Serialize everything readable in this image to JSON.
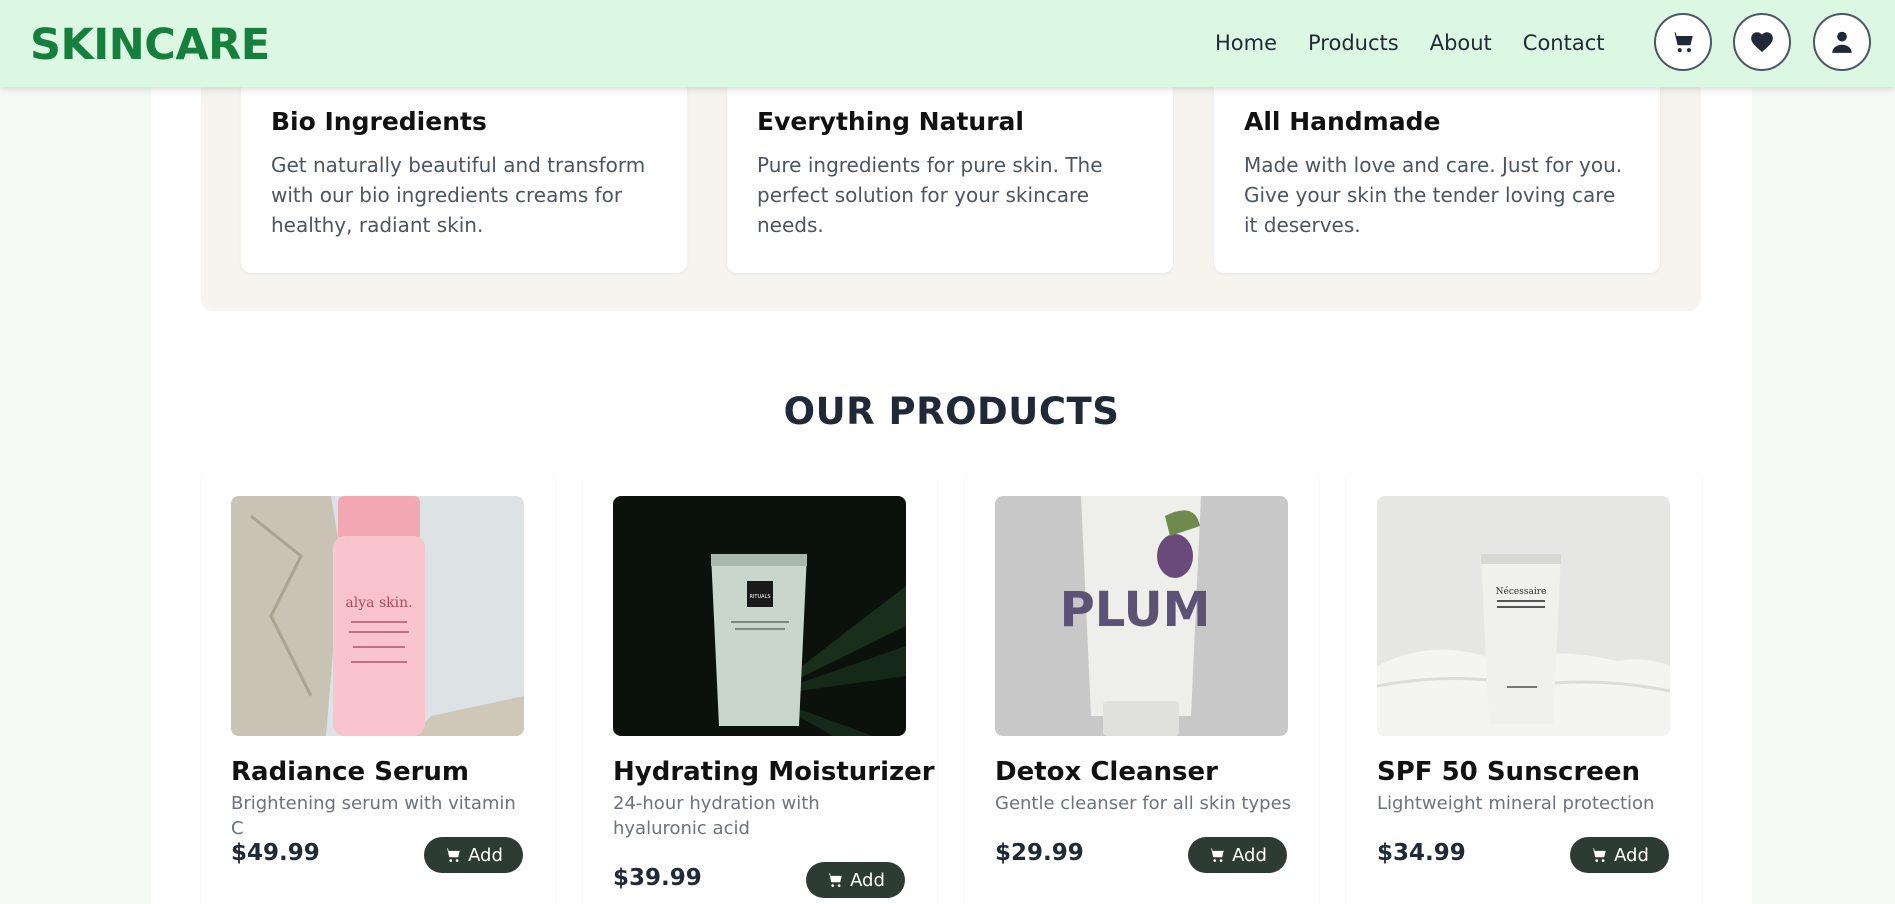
{
  "brand": {
    "logo": "SKINCARE"
  },
  "nav": {
    "items": [
      "Home",
      "Products",
      "About",
      "Contact"
    ]
  },
  "header_icons": [
    "cart-icon",
    "heart-icon",
    "user-icon"
  ],
  "features": [
    {
      "title": "Bio Ingredients",
      "text": "Get naturally beautiful and transform with our bio ingredients creams for healthy, radiant skin."
    },
    {
      "title": "Everything Natural",
      "text": "Pure ingredients for pure skin. The perfect solution for your skincare needs."
    },
    {
      "title": "All Handmade",
      "text": "Made with love and care. Just for you. Give your skin the tender loving care it deserves."
    }
  ],
  "products_section": {
    "title": "OUR PRODUCTS",
    "add_label": "Add",
    "items": [
      {
        "name": "Radiance Serum",
        "description": "Brightening serum with vitamin C",
        "price": "$49.99",
        "image_text": "alya skin."
      },
      {
        "name": "Hydrating Moisturizer",
        "description": "24-hour hydration with hyaluronic acid",
        "price": "$39.99",
        "image_text": "RITUALS"
      },
      {
        "name": "Detox Cleanser",
        "description": "Gentle cleanser for all skin types",
        "price": "$29.99",
        "image_text": "PLUM"
      },
      {
        "name": "SPF 50 Sunscreen",
        "description": "Lightweight mineral protection",
        "price": "$34.99",
        "image_text": "Nécessaire"
      }
    ]
  },
  "colors": {
    "brand_green": "#15803d",
    "header_bg": "#dcf8e3",
    "button_dark": "#2d3b35"
  }
}
